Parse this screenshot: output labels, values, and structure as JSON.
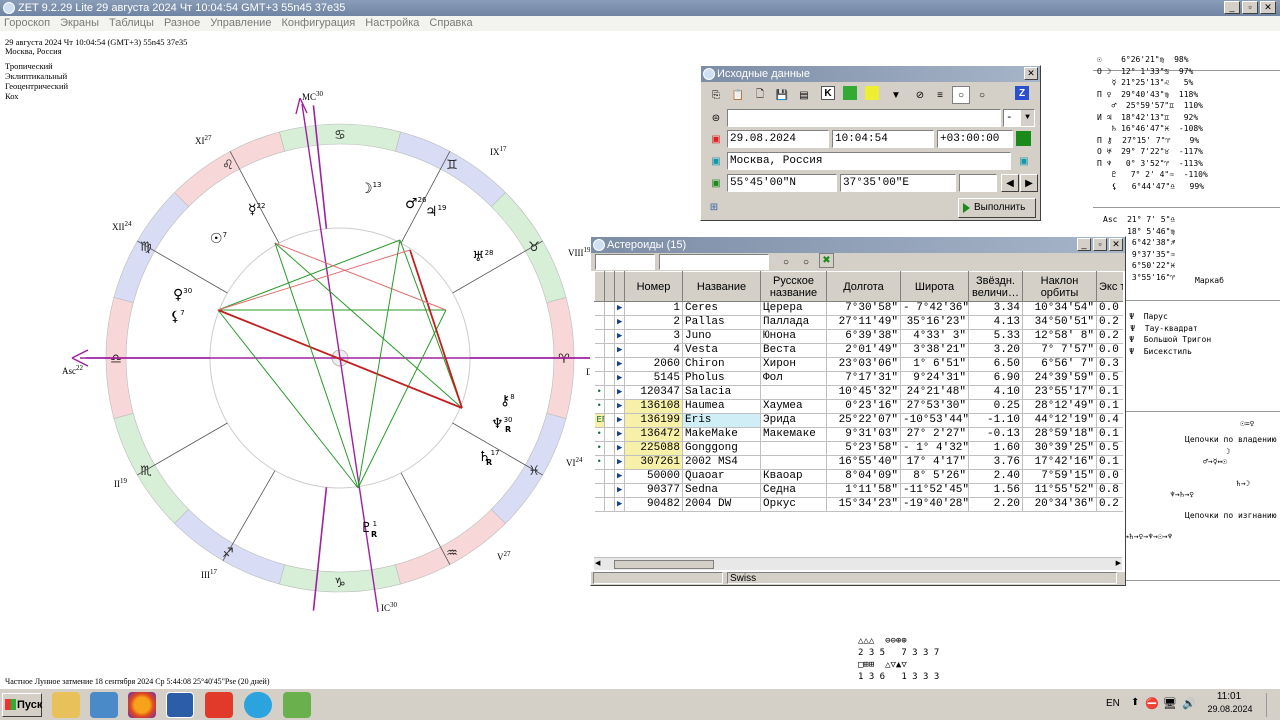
{
  "title_bar": {
    "text": "ZET 9.2.29 Lite   29 августа 2024  Чт  10:04:54 GMT+3 55n45  37e35"
  },
  "window_buttons": [
    "_",
    "▫",
    "✕"
  ],
  "menu": [
    "Гороскоп",
    "Экраны",
    "Таблицы",
    "Разное",
    "Управление",
    "Конфигурация",
    "Настройка",
    "Справка"
  ],
  "chart_header": {
    "line1": "29 августа 2024  Чт  10:04:54 (GMT+3) 55n45  37e35",
    "line2": "Москва, Россия"
  },
  "chart_settings": [
    "Тропический",
    "Эклиптикальный",
    "Геоцентрический",
    "Кох"
  ],
  "houses": [
    {
      "label": "MC",
      "deg": "30"
    },
    {
      "label": "IX",
      "deg": "17"
    },
    {
      "label": "VIII",
      "deg": "19"
    },
    {
      "label": "D",
      "deg": ""
    },
    {
      "label": "VI",
      "deg": "24"
    },
    {
      "label": "V",
      "deg": "27"
    },
    {
      "label": "IC",
      "deg": "30"
    },
    {
      "label": "III",
      "deg": "17"
    },
    {
      "label": "II",
      "deg": "19"
    },
    {
      "label": "Asc",
      "deg": "22"
    },
    {
      "label": "XII",
      "deg": "24"
    },
    {
      "label": "XI",
      "deg": "27"
    }
  ],
  "planets_on_chart": [
    {
      "glyph": "☽",
      "deg": "13"
    },
    {
      "glyph": "♂",
      "deg": "26"
    },
    {
      "glyph": "♃",
      "deg": "19"
    },
    {
      "glyph": "♅",
      "deg": "28"
    },
    {
      "glyph": "☿",
      "deg": "22"
    },
    {
      "glyph": "☉",
      "deg": "7"
    },
    {
      "glyph": "♀",
      "deg": "30"
    },
    {
      "glyph": "⚸",
      "deg": "7"
    },
    {
      "glyph": "⚷",
      "deg": "8"
    },
    {
      "glyph": "♆",
      "deg": "30"
    },
    {
      "glyph": "R",
      "deg": ""
    },
    {
      "glyph": "♄",
      "deg": "17"
    },
    {
      "glyph": "R",
      "deg": ""
    },
    {
      "glyph": "♇",
      "deg": "1"
    },
    {
      "glyph": "R",
      "deg": ""
    }
  ],
  "eclipse_note": "Частное Лунное затмение 18 сентября 2024 Ср  5:44:08 25°40'45\"Pse (20 дней)",
  "source_dialog": {
    "title": "Исходные данные",
    "date": "29.08.2024",
    "time": "10:04:54",
    "tz": "+03:00:00",
    "place": "Москва, Россия",
    "lat": "55°45'00\"N",
    "lon": "37°35'00\"E",
    "dash": "-",
    "execute_label": "Выполнить",
    "toolbar_letters": [
      "K",
      "Z"
    ]
  },
  "asteroids": {
    "title": "Астероиды (15)",
    "headers": [
      "Номер",
      "Название",
      "Русское название",
      "Долгота",
      "Широта",
      "Звёздн. величи…",
      "Наклон орбиты",
      "Экс тр"
    ],
    "rows": [
      {
        "mark": "",
        "num": "1",
        "name": "Ceres",
        "ru": "Церера",
        "lon": "7°30'58\"",
        "lat": "- 7°42'36\"",
        "mag": "3.34",
        "incl": "10°34'54\"",
        "ex": "0.0"
      },
      {
        "mark": "",
        "num": "2",
        "name": "Pallas",
        "ru": "Паллада",
        "lon": "27°11'49\"",
        "lat": "35°16'23\"",
        "mag": "4.13",
        "incl": "34°50'51\"",
        "ex": "0.2"
      },
      {
        "mark": "",
        "num": "3",
        "name": "Juno",
        "ru": "Юнона",
        "lon": "6°39'38\"",
        "lat": "4°33' 3\"",
        "mag": "5.33",
        "incl": "12°58' 8\"",
        "ex": "0.2"
      },
      {
        "mark": "",
        "num": "4",
        "name": "Vesta",
        "ru": "Веста",
        "lon": "2°01'49\"",
        "lat": "3°38'21\"",
        "mag": "3.20",
        "incl": "7° 7'57\"",
        "ex": "0.0"
      },
      {
        "mark": "",
        "num": "2060",
        "name": "Chiron",
        "ru": "Хирон",
        "lon": "23°03'06\"",
        "lat": "1° 6'51\"",
        "mag": "6.50",
        "incl": "6°56' 7\"",
        "ex": "0.3"
      },
      {
        "mark": "",
        "num": "5145",
        "name": "Pholus",
        "ru": "Фол",
        "lon": "7°17'31\"",
        "lat": "9°24'31\"",
        "mag": "6.90",
        "incl": "24°39'59\"",
        "ex": "0.5"
      },
      {
        "mark": "•",
        "num": "120347",
        "name": "Salacia",
        "ru": "",
        "lon": "10°45'32\"",
        "lat": "24°21'48\"",
        "mag": "4.10",
        "incl": "23°55'17\"",
        "ex": "0.1"
      },
      {
        "mark": "•",
        "num": "136108",
        "name": "Haumea",
        "ru": "Хаумеа",
        "lon": "0°23'16\"",
        "lat": "27°53'30\"",
        "mag": "0.25",
        "incl": "28°12'49\"",
        "ex": "0.1"
      },
      {
        "mark": "ER",
        "num": "136199",
        "name": "Eris",
        "ru": "Эрида",
        "lon": "25°22'07\"",
        "lat": "-10°53'44\"",
        "mag": "-1.10",
        "incl": "44°12'19\"",
        "ex": "0.4"
      },
      {
        "mark": "•",
        "num": "136472",
        "name": "MakeMake",
        "ru": "Макемаке",
        "lon": "9°31'03\"",
        "lat": "27° 2'27\"",
        "mag": "-0.13",
        "incl": "28°59'18\"",
        "ex": "0.1"
      },
      {
        "mark": "•",
        "num": "225088",
        "name": "Gonggong",
        "ru": "",
        "lon": "5°23'58\"",
        "lat": "- 1° 4'32\"",
        "mag": "1.60",
        "incl": "30°39'25\"",
        "ex": "0.5"
      },
      {
        "mark": "•",
        "num": "307261",
        "name": "2002 MS4",
        "ru": "",
        "lon": "16°55'40\"",
        "lat": "17° 4'17\"",
        "mag": "3.76",
        "incl": "17°42'16\"",
        "ex": "0.1"
      },
      {
        "mark": "",
        "num": "50000",
        "name": "Quaoar",
        "ru": "Квaoар",
        "lon": "8°04'09\"",
        "lat": "8° 5'26\"",
        "mag": "2.40",
        "incl": "7°59'15\"",
        "ex": "0.0"
      },
      {
        "mark": "",
        "num": "90377",
        "name": "Sedna",
        "ru": "Седна",
        "lon": "1°11'58\"",
        "lat": "-11°52'45\"",
        "mag": "1.56",
        "incl": "11°55'52\"",
        "ex": "0.8"
      },
      {
        "mark": "",
        "num": "90482",
        "name": "2004 DW",
        "ru": "Оркус",
        "lon": "15°34'23\"",
        "lat": "-19°40'28\"",
        "mag": "2.20",
        "incl": "20°34'36\"",
        "ex": "0.2"
      }
    ],
    "status": "Swiss"
  },
  "right_panel": {
    "planets": [
      "☉    6°26'21\"♍  98%",
      "О ☽  12° 1'33\"♋  97%",
      "   ☿ 21°25'13\"♌   5%",
      "П ♀  29°40'43\"♍  118%",
      "   ♂  25°59'57\"♊  110%",
      "И ♃  18°42'13\"♊   92%",
      "   ♄ 16°46'47\"♓  -108%",
      "П ⚷  27°15' 7\"♈    9%",
      "О ♅  29° 7'22\"♉  -117%",
      "П ♆   0° 3'52\"♈  -113%",
      "   ♇   7° 2' 4\"♒  -110%",
      "   ⚸   6°44'47\"♎   99%"
    ],
    "cusps": [
      "Asc  21° 7' 5\"♎",
      "     18° 5'46\"♍",
      "      6°42'38\"♐",
      "      9°37'35\"♒",
      "      6°50'22\"♓",
      "      3°55'16\"♈"
    ],
    "markab": "Маркаб",
    "figures": [
      "☿ ♆ Ψ  Парус",
      "⚸ ♀ Ψ  Тау-квадрат",
      "♁ ♆ Ψ  Большой Тригон",
      "♁ ♆ Ψ  Бисекстиль"
    ],
    "chain_top": "☉=♀",
    "chains_ownership_title": "Цепочки по владению",
    "chains_exile_title": "Цепочки по изгнанию",
    "chain_lines": [
      "☽",
      "♂→☿↔☉",
      "♆→♄→♀",
      "♄→☽"
    ],
    "exile_lines": [
      "☽→♄→♆→♄→♀→♆→☉→♆",
      "♂→♃"
    ]
  },
  "bottom_table": {
    "row1": "2 3 5   7 3 3 7",
    "row2": "1 3 6   1 3 3 3"
  },
  "taskbar": {
    "start": "Пуск",
    "lang": "EN",
    "time": "11:01",
    "date": "29.08.2024"
  }
}
